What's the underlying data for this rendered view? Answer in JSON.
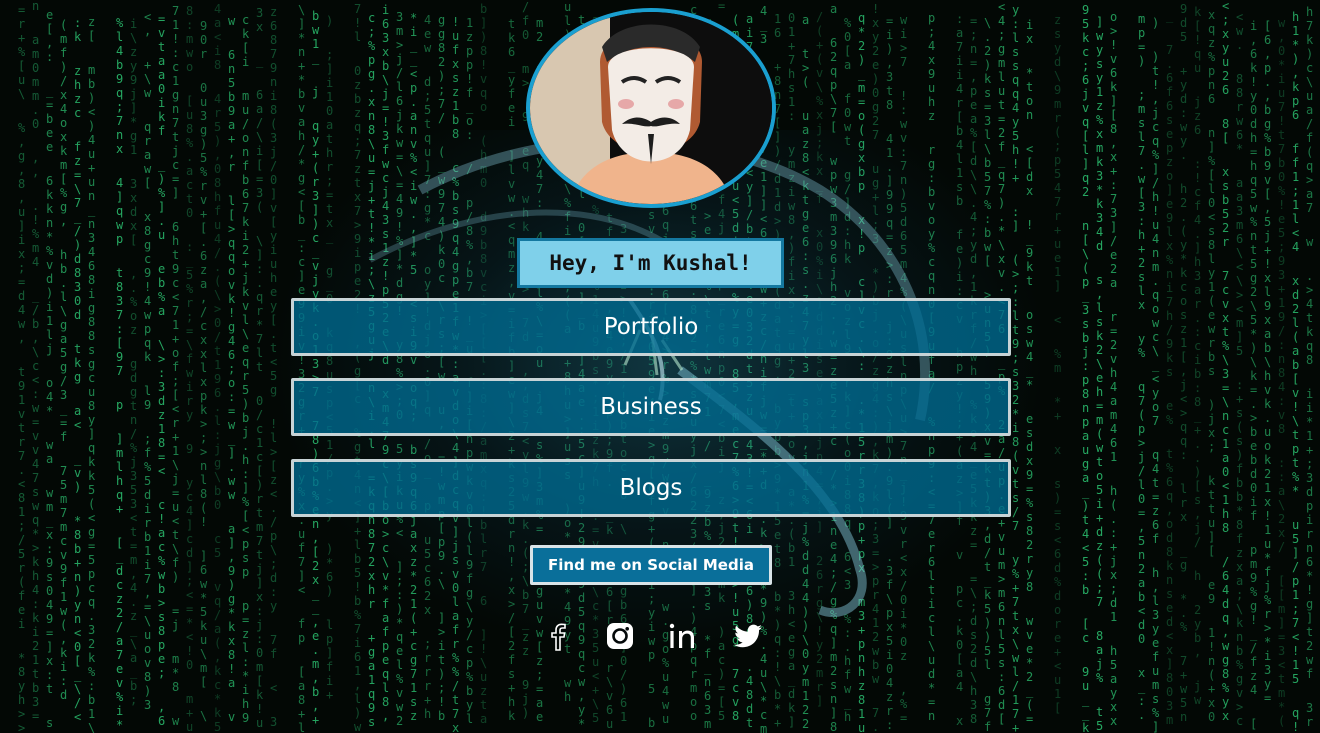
{
  "profile": {
    "greeting": "Hey, I'm Kushal!",
    "avatar_icon": "masked-person-avatar"
  },
  "links": [
    {
      "label": "Portfolio"
    },
    {
      "label": "Business"
    },
    {
      "label": "Blogs"
    }
  ],
  "social": {
    "button_label": "Find me on Social Media",
    "icons": [
      "facebook-icon",
      "instagram-icon",
      "linkedin-icon",
      "twitter-icon"
    ]
  },
  "colors": {
    "accent": "#1a9fd0",
    "link_button_bg": "#006c92",
    "greeting_bg": "#7fd0ea",
    "matrix_green": "#2fd27a"
  }
}
